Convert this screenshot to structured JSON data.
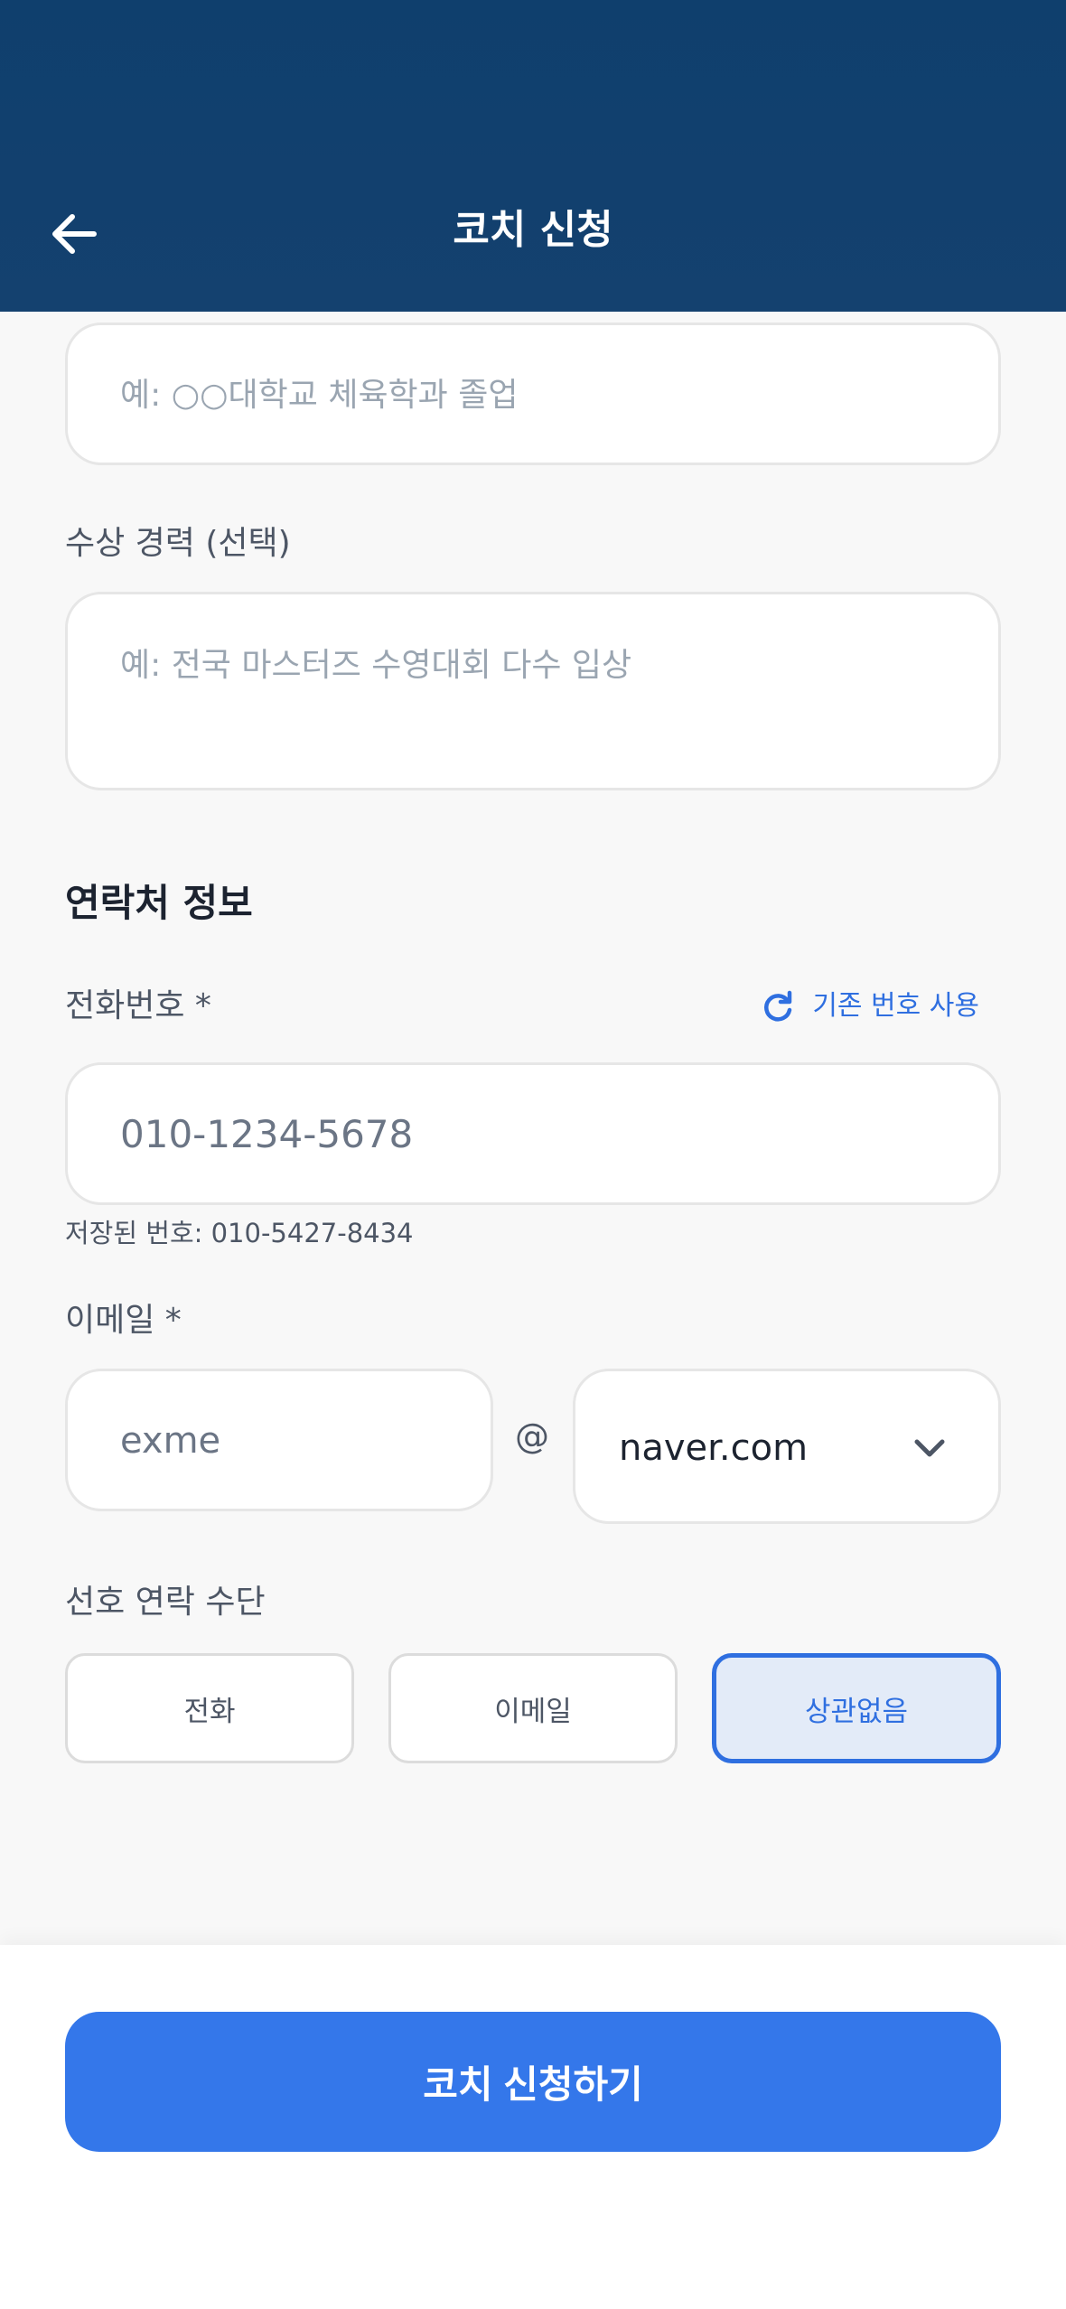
{
  "header": {
    "title": "코치 신청"
  },
  "form": {
    "education": {
      "placeholder": "예: ○○대학교 체육학과 졸업"
    },
    "awards": {
      "label": "수상 경력 (선택)",
      "placeholder": "예: 전국 마스터즈 수영대회 다수 입상"
    },
    "contact_section": {
      "title": "연락처 정보"
    },
    "phone": {
      "label": "전화번호 *",
      "reuse_label": "기존 번호 사용",
      "placeholder": "010-1234-5678",
      "saved_hint": "저장된 번호: 010-5427-8434"
    },
    "email": {
      "label": "이메일 *",
      "local_value": "exme",
      "at": "@",
      "domain_value": "naver.com"
    },
    "preferred_contact": {
      "label": "선호 연락 수단",
      "options": [
        "전화",
        "이메일",
        "상관없음"
      ],
      "selected": "상관없음"
    }
  },
  "footer": {
    "submit_label": "코치 신청하기"
  },
  "colors": {
    "header": "#0f3f6d",
    "accent": "#3477ea",
    "selected_bg": "#e3ebf8"
  },
  "icons": {
    "back": "arrow-left-icon",
    "refresh": "refresh-icon",
    "dropdown": "chevron-down-icon"
  }
}
